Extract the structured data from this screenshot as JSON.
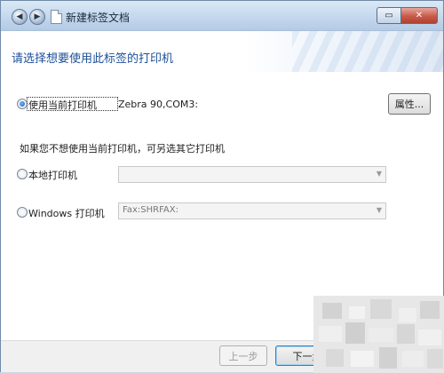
{
  "window": {
    "title": "新建标签文档",
    "controls": {
      "maximize": "▭",
      "close": "✕"
    },
    "nav": {
      "back": "◀",
      "forward": "▶"
    }
  },
  "header": {
    "text": "请选择想要使用此标签的打印机"
  },
  "current_printer": {
    "label": "使用当前打印机",
    "value": "Zebra 90,COM3:",
    "selected": true,
    "properties_button": "属性..."
  },
  "instruction": "如果您不想使用当前打印机，可另选其它打印机",
  "local_printer": {
    "label": "本地打印机",
    "value": "",
    "selected": false
  },
  "windows_printer": {
    "label": "Windows 打印机",
    "value": "Fax:SHRFAX:",
    "selected": false
  },
  "footer": {
    "back_button": "上一步",
    "next_button": "下一步"
  },
  "colors": {
    "header_text": "#1e4f98",
    "titlebar": "#c6d9ee",
    "accent": "#1c5fb8"
  }
}
